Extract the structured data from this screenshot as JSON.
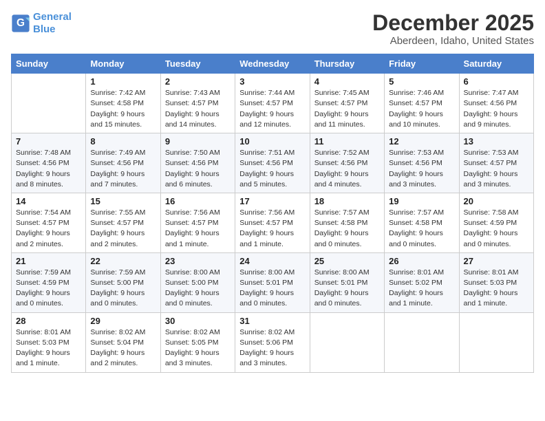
{
  "header": {
    "logo_line1": "General",
    "logo_line2": "Blue",
    "title": "December 2025",
    "subtitle": "Aberdeen, Idaho, United States"
  },
  "columns": [
    "Sunday",
    "Monday",
    "Tuesday",
    "Wednesday",
    "Thursday",
    "Friday",
    "Saturday"
  ],
  "weeks": [
    [
      {
        "day": "",
        "info": ""
      },
      {
        "day": "1",
        "info": "Sunrise: 7:42 AM\nSunset: 4:58 PM\nDaylight: 9 hours\nand 15 minutes."
      },
      {
        "day": "2",
        "info": "Sunrise: 7:43 AM\nSunset: 4:57 PM\nDaylight: 9 hours\nand 14 minutes."
      },
      {
        "day": "3",
        "info": "Sunrise: 7:44 AM\nSunset: 4:57 PM\nDaylight: 9 hours\nand 12 minutes."
      },
      {
        "day": "4",
        "info": "Sunrise: 7:45 AM\nSunset: 4:57 PM\nDaylight: 9 hours\nand 11 minutes."
      },
      {
        "day": "5",
        "info": "Sunrise: 7:46 AM\nSunset: 4:57 PM\nDaylight: 9 hours\nand 10 minutes."
      },
      {
        "day": "6",
        "info": "Sunrise: 7:47 AM\nSunset: 4:56 PM\nDaylight: 9 hours\nand 9 minutes."
      }
    ],
    [
      {
        "day": "7",
        "info": "Sunrise: 7:48 AM\nSunset: 4:56 PM\nDaylight: 9 hours\nand 8 minutes."
      },
      {
        "day": "8",
        "info": "Sunrise: 7:49 AM\nSunset: 4:56 PM\nDaylight: 9 hours\nand 7 minutes."
      },
      {
        "day": "9",
        "info": "Sunrise: 7:50 AM\nSunset: 4:56 PM\nDaylight: 9 hours\nand 6 minutes."
      },
      {
        "day": "10",
        "info": "Sunrise: 7:51 AM\nSunset: 4:56 PM\nDaylight: 9 hours\nand 5 minutes."
      },
      {
        "day": "11",
        "info": "Sunrise: 7:52 AM\nSunset: 4:56 PM\nDaylight: 9 hours\nand 4 minutes."
      },
      {
        "day": "12",
        "info": "Sunrise: 7:53 AM\nSunset: 4:56 PM\nDaylight: 9 hours\nand 3 minutes."
      },
      {
        "day": "13",
        "info": "Sunrise: 7:53 AM\nSunset: 4:57 PM\nDaylight: 9 hours\nand 3 minutes."
      }
    ],
    [
      {
        "day": "14",
        "info": "Sunrise: 7:54 AM\nSunset: 4:57 PM\nDaylight: 9 hours\nand 2 minutes."
      },
      {
        "day": "15",
        "info": "Sunrise: 7:55 AM\nSunset: 4:57 PM\nDaylight: 9 hours\nand 2 minutes."
      },
      {
        "day": "16",
        "info": "Sunrise: 7:56 AM\nSunset: 4:57 PM\nDaylight: 9 hours\nand 1 minute."
      },
      {
        "day": "17",
        "info": "Sunrise: 7:56 AM\nSunset: 4:57 PM\nDaylight: 9 hours\nand 1 minute."
      },
      {
        "day": "18",
        "info": "Sunrise: 7:57 AM\nSunset: 4:58 PM\nDaylight: 9 hours\nand 0 minutes."
      },
      {
        "day": "19",
        "info": "Sunrise: 7:57 AM\nSunset: 4:58 PM\nDaylight: 9 hours\nand 0 minutes."
      },
      {
        "day": "20",
        "info": "Sunrise: 7:58 AM\nSunset: 4:59 PM\nDaylight: 9 hours\nand 0 minutes."
      }
    ],
    [
      {
        "day": "21",
        "info": "Sunrise: 7:59 AM\nSunset: 4:59 PM\nDaylight: 9 hours\nand 0 minutes."
      },
      {
        "day": "22",
        "info": "Sunrise: 7:59 AM\nSunset: 5:00 PM\nDaylight: 9 hours\nand 0 minutes."
      },
      {
        "day": "23",
        "info": "Sunrise: 8:00 AM\nSunset: 5:00 PM\nDaylight: 9 hours\nand 0 minutes."
      },
      {
        "day": "24",
        "info": "Sunrise: 8:00 AM\nSunset: 5:01 PM\nDaylight: 9 hours\nand 0 minutes."
      },
      {
        "day": "25",
        "info": "Sunrise: 8:00 AM\nSunset: 5:01 PM\nDaylight: 9 hours\nand 0 minutes."
      },
      {
        "day": "26",
        "info": "Sunrise: 8:01 AM\nSunset: 5:02 PM\nDaylight: 9 hours\nand 1 minute."
      },
      {
        "day": "27",
        "info": "Sunrise: 8:01 AM\nSunset: 5:03 PM\nDaylight: 9 hours\nand 1 minute."
      }
    ],
    [
      {
        "day": "28",
        "info": "Sunrise: 8:01 AM\nSunset: 5:03 PM\nDaylight: 9 hours\nand 1 minute."
      },
      {
        "day": "29",
        "info": "Sunrise: 8:02 AM\nSunset: 5:04 PM\nDaylight: 9 hours\nand 2 minutes."
      },
      {
        "day": "30",
        "info": "Sunrise: 8:02 AM\nSunset: 5:05 PM\nDaylight: 9 hours\nand 3 minutes."
      },
      {
        "day": "31",
        "info": "Sunrise: 8:02 AM\nSunset: 5:06 PM\nDaylight: 9 hours\nand 3 minutes."
      },
      {
        "day": "",
        "info": ""
      },
      {
        "day": "",
        "info": ""
      },
      {
        "day": "",
        "info": ""
      }
    ]
  ]
}
